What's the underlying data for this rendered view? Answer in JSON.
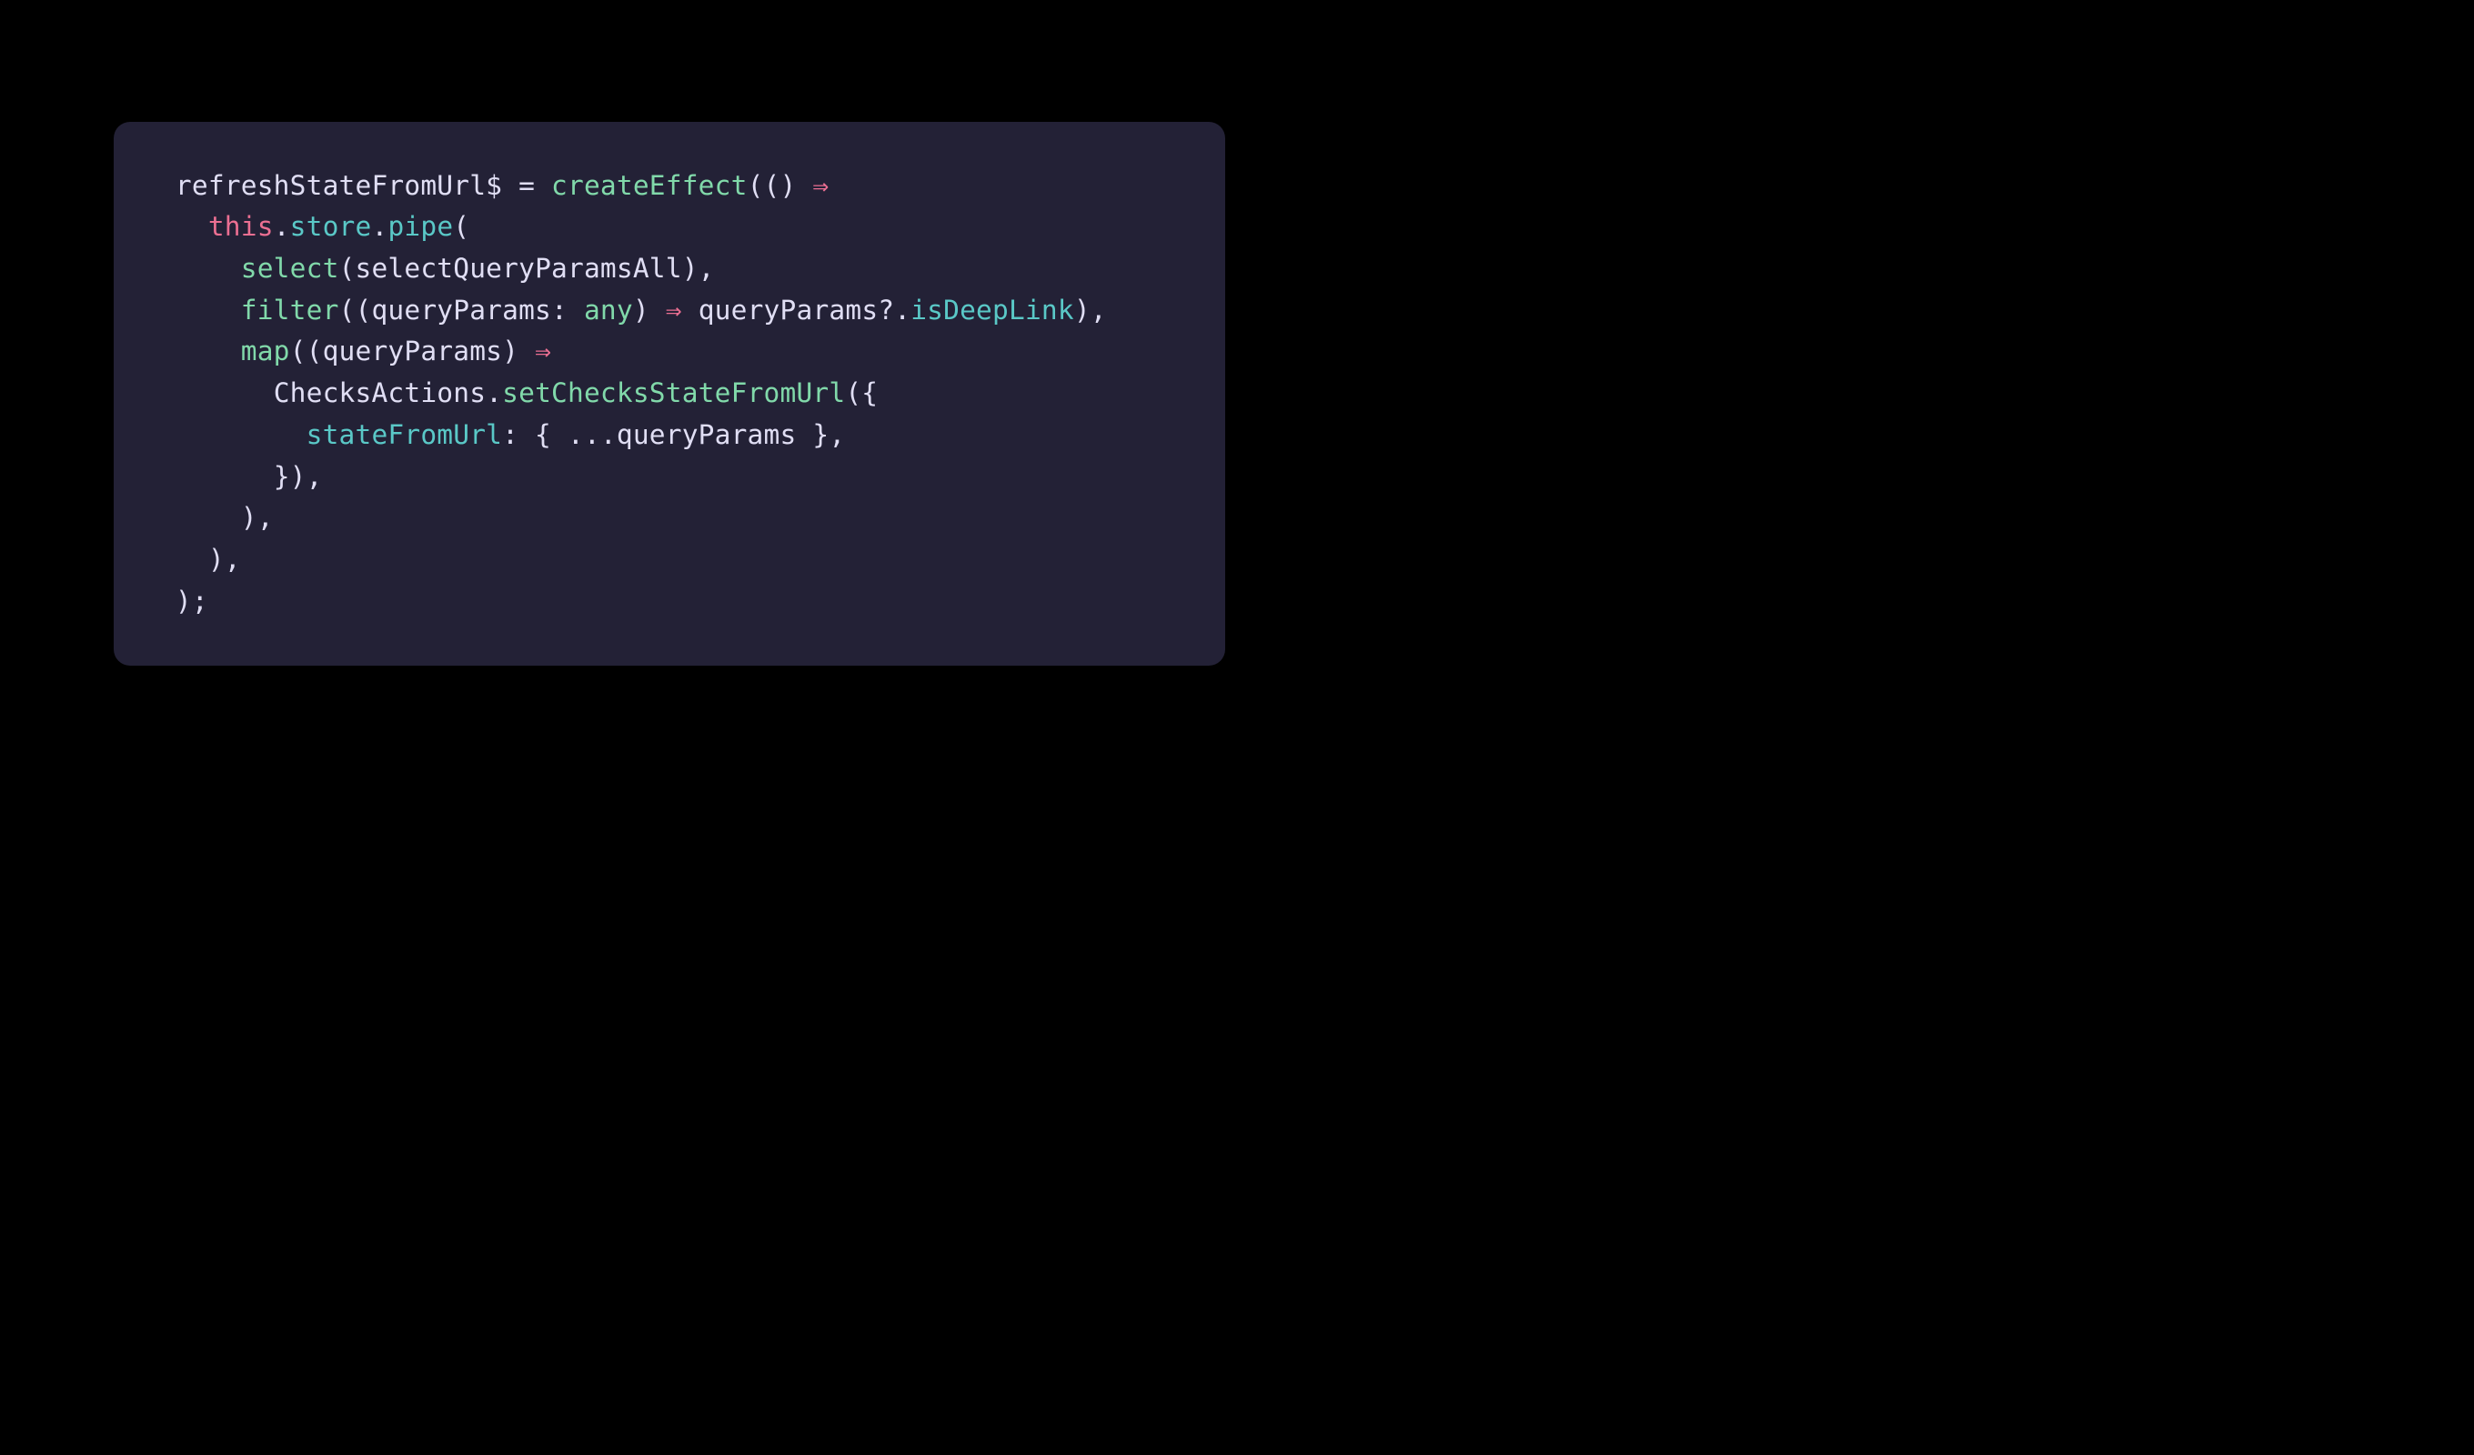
{
  "code": {
    "language": "typescript",
    "tokens": [
      {
        "line": 0,
        "indent": 0,
        "parts": [
          {
            "t": "  ",
            "c": "punct"
          },
          {
            "t": "refreshStateFromUrl$",
            "c": "prop"
          },
          {
            "t": " = ",
            "c": "punct"
          },
          {
            "t": "createEffect",
            "c": "fn"
          },
          {
            "t": "(()",
            "c": "punct"
          },
          {
            "t": " ",
            "c": "punct"
          },
          {
            "t": "⇒",
            "c": "arrow"
          }
        ]
      },
      {
        "line": 1,
        "indent": 2,
        "parts": [
          {
            "t": "this",
            "c": "kw"
          },
          {
            "t": ".",
            "c": "punct"
          },
          {
            "t": "store",
            "c": "method"
          },
          {
            "t": ".",
            "c": "punct"
          },
          {
            "t": "pipe",
            "c": "method"
          },
          {
            "t": "(",
            "c": "punct"
          }
        ]
      },
      {
        "line": 2,
        "indent": 3,
        "parts": [
          {
            "t": "select",
            "c": "fn"
          },
          {
            "t": "(",
            "c": "punct"
          },
          {
            "t": "selectQueryParamsAll",
            "c": "prop"
          },
          {
            "t": "),",
            "c": "punct"
          }
        ]
      },
      {
        "line": 3,
        "indent": 3,
        "parts": [
          {
            "t": "filter",
            "c": "fn"
          },
          {
            "t": "((",
            "c": "punct"
          },
          {
            "t": "queryParams",
            "c": "prop"
          },
          {
            "t": ": ",
            "c": "punct"
          },
          {
            "t": "any",
            "c": "fn"
          },
          {
            "t": ")",
            "c": "punct"
          },
          {
            "t": " ",
            "c": "punct"
          },
          {
            "t": "⇒",
            "c": "arrow"
          },
          {
            "t": " ",
            "c": "punct"
          },
          {
            "t": "queryParams",
            "c": "prop"
          },
          {
            "t": "?.",
            "c": "punct"
          },
          {
            "t": "isDeepLink",
            "c": "method"
          },
          {
            "t": "),",
            "c": "punct"
          }
        ]
      },
      {
        "line": 4,
        "indent": 3,
        "parts": [
          {
            "t": "map",
            "c": "fn"
          },
          {
            "t": "((",
            "c": "punct"
          },
          {
            "t": "queryParams",
            "c": "prop"
          },
          {
            "t": ")",
            "c": "punct"
          },
          {
            "t": " ",
            "c": "punct"
          },
          {
            "t": "⇒",
            "c": "arrow"
          }
        ]
      },
      {
        "line": 5,
        "indent": 4,
        "parts": [
          {
            "t": "ChecksActions",
            "c": "prop"
          },
          {
            "t": ".",
            "c": "punct"
          },
          {
            "t": "setChecksStateFromUrl",
            "c": "fn"
          },
          {
            "t": "({",
            "c": "punct"
          }
        ]
      },
      {
        "line": 6,
        "indent": 5,
        "parts": [
          {
            "t": "stateFromUrl",
            "c": "method"
          },
          {
            "t": ": { ...",
            "c": "punct"
          },
          {
            "t": "queryParams",
            "c": "prop"
          },
          {
            "t": " },",
            "c": "punct"
          }
        ]
      },
      {
        "line": 7,
        "indent": 4,
        "parts": [
          {
            "t": "}),",
            "c": "punct"
          }
        ]
      },
      {
        "line": 8,
        "indent": 3,
        "parts": [
          {
            "t": "),",
            "c": "punct"
          }
        ]
      },
      {
        "line": 9,
        "indent": 2,
        "parts": [
          {
            "t": "),",
            "c": "punct"
          }
        ]
      },
      {
        "line": 10,
        "indent": 1,
        "parts": [
          {
            "t": ");",
            "c": "punct"
          }
        ]
      }
    ]
  }
}
